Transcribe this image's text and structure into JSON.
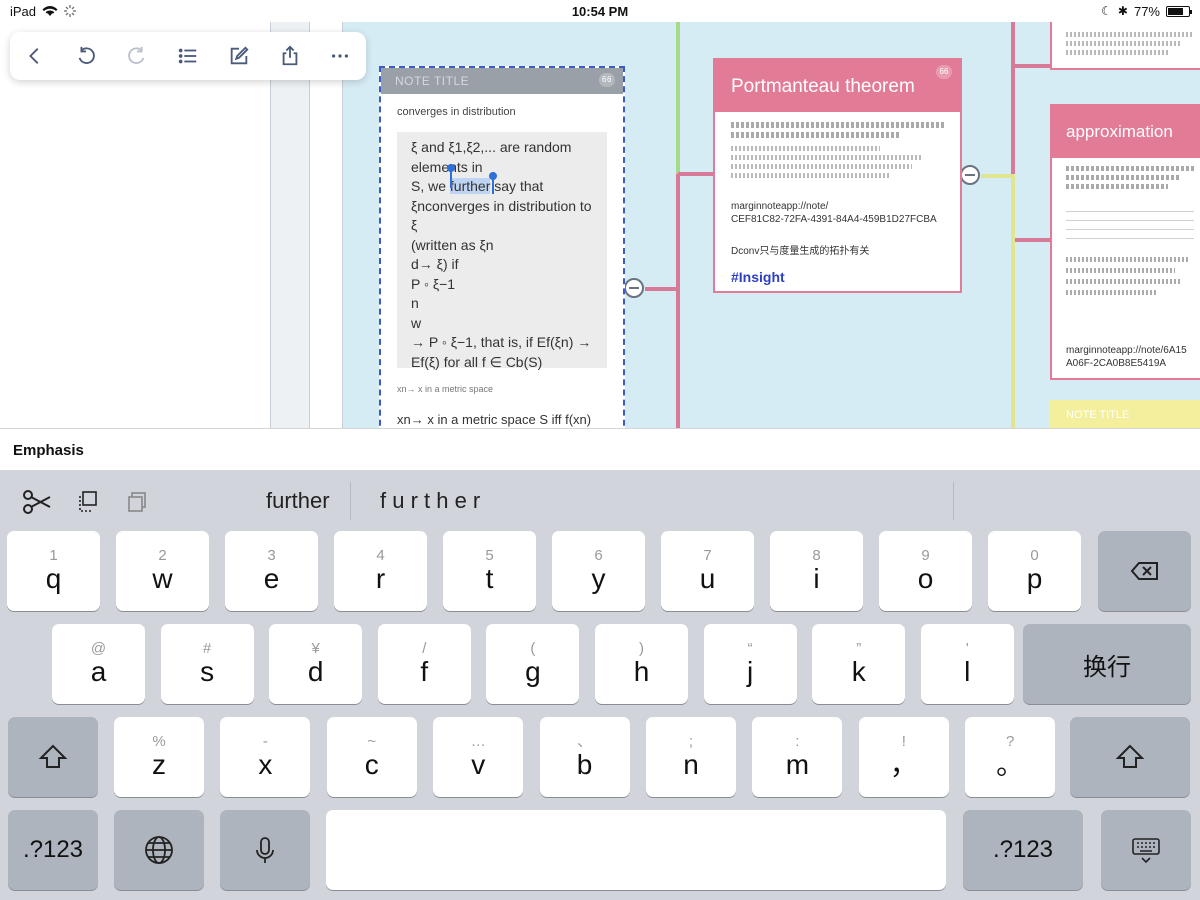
{
  "status_bar": {
    "device": "iPad",
    "time": "10:54 PM",
    "battery": "77%",
    "battery_fraction": 0.77
  },
  "toolbar": {
    "buttons": [
      {
        "name": "back",
        "icon": "chevron-left-icon"
      },
      {
        "name": "undo",
        "icon": "undo-icon"
      },
      {
        "name": "redo",
        "icon": "redo-icon"
      },
      {
        "name": "outline",
        "icon": "list-icon"
      },
      {
        "name": "edit",
        "icon": "pencil-square-icon"
      },
      {
        "name": "share",
        "icon": "share-icon"
      },
      {
        "name": "more",
        "icon": "ellipsis-icon"
      }
    ]
  },
  "card_main": {
    "title": "NOTE TITLE",
    "badge": "66",
    "subtitle": "converges in distribution",
    "excerpt_lines": [
      "ξ and ξ1,ξ2,... are random",
      "elements in",
      "S, we ",
      "ξnconverges in distribution to ξ",
      "(written as ξn",
      "d→ ξ) if",
      "P ◦ ξ−1",
      "n",
      "w",
      "→ P ◦ ξ−1, that is, if Ef(ξn) →",
      "Ef(ξ) for all f ∈ Cb(S)"
    ],
    "selected_word": "further",
    "after_selection": " say that",
    "small_note": "xn→ x in a metric space",
    "tail": "xn→ x in a metric space S iff f(xn)"
  },
  "card_portmanteau": {
    "title": "Portmanteau theorem",
    "badge": "66",
    "link_label": "marginnoteapp://note/",
    "link_id": "CEF81C82-72FA-4391-84A4-459B1D27FCBA",
    "chinese_note": "Dconv只与度量生成的拓扑有关",
    "tag": "#Insight"
  },
  "card_approximation": {
    "title": "approximation",
    "link_label": "marginnoteapp://note/6A15",
    "link_id": "A06F-2CA0B8E5419A"
  },
  "card_bottom": {
    "title": "NOTE TITLE"
  },
  "emphasis_label": "Emphasis",
  "suggestions": {
    "word": "further",
    "spaced": "f u r t h e r"
  },
  "keyboard": {
    "row1": [
      {
        "hint": "1",
        "key": "q"
      },
      {
        "hint": "2",
        "key": "w"
      },
      {
        "hint": "3",
        "key": "e"
      },
      {
        "hint": "4",
        "key": "r"
      },
      {
        "hint": "5",
        "key": "t"
      },
      {
        "hint": "6",
        "key": "y"
      },
      {
        "hint": "7",
        "key": "u"
      },
      {
        "hint": "8",
        "key": "i"
      },
      {
        "hint": "9",
        "key": "o"
      },
      {
        "hint": "0",
        "key": "p"
      }
    ],
    "row2": [
      {
        "hint": "@",
        "key": "a"
      },
      {
        "hint": "#",
        "key": "s"
      },
      {
        "hint": "¥",
        "key": "d"
      },
      {
        "hint": "/",
        "key": "f"
      },
      {
        "hint": "(",
        "key": "g"
      },
      {
        "hint": ")",
        "key": "h"
      },
      {
        "hint": "“",
        "key": "j"
      },
      {
        "hint": "”",
        "key": "k"
      },
      {
        "hint": "'",
        "key": "l"
      }
    ],
    "row3": [
      {
        "hint": "%",
        "key": "z"
      },
      {
        "hint": "-",
        "key": "x"
      },
      {
        "hint": "~",
        "key": "c"
      },
      {
        "hint": "…",
        "key": "v"
      },
      {
        "hint": "、",
        "key": "b"
      },
      {
        "hint": ";",
        "key": "n"
      },
      {
        "hint": ":",
        "key": "m"
      },
      {
        "hint": "!",
        "key": "，"
      },
      {
        "hint": "?",
        "key": "。"
      }
    ],
    "return_label": "换行",
    "numbers_label": ".?123"
  }
}
